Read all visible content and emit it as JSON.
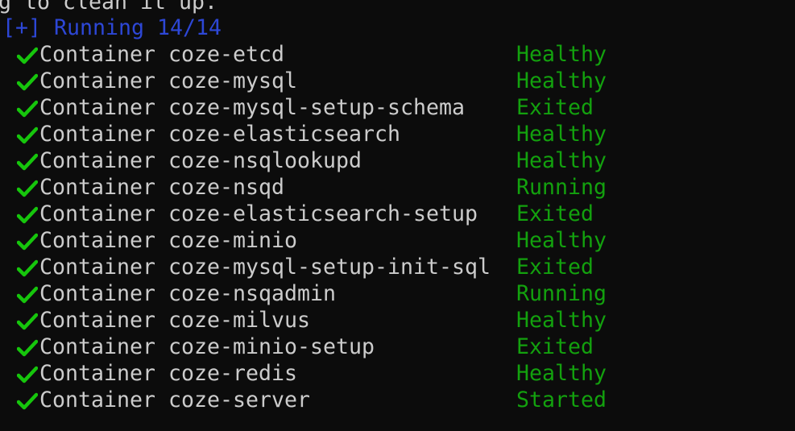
{
  "terminal": {
    "previous_line": "g to clean it up.",
    "progress_line": "[+] Running 14/14",
    "colors": {
      "background": "#0c0c0c",
      "text": "#cccccc",
      "progress": "#2d47d6",
      "status": "#13a10e",
      "check": "#16c60c"
    },
    "status_icon": "check-icon",
    "containers": [
      {
        "label": "Container coze-etcd",
        "status": "Healthy"
      },
      {
        "label": "Container coze-mysql",
        "status": "Healthy"
      },
      {
        "label": "Container coze-mysql-setup-schema",
        "status": "Exited"
      },
      {
        "label": "Container coze-elasticsearch",
        "status": "Healthy"
      },
      {
        "label": "Container coze-nsqlookupd",
        "status": "Healthy"
      },
      {
        "label": "Container coze-nsqd",
        "status": "Running"
      },
      {
        "label": "Container coze-elasticsearch-setup",
        "status": "Exited"
      },
      {
        "label": "Container coze-minio",
        "status": "Healthy"
      },
      {
        "label": "Container coze-mysql-setup-init-sql",
        "status": "Exited"
      },
      {
        "label": "Container coze-nsqadmin",
        "status": "Running"
      },
      {
        "label": "Container coze-milvus",
        "status": "Healthy"
      },
      {
        "label": "Container coze-minio-setup",
        "status": "Exited"
      },
      {
        "label": "Container coze-redis",
        "status": "Healthy"
      },
      {
        "label": "Container coze-server",
        "status": "Started"
      }
    ]
  }
}
